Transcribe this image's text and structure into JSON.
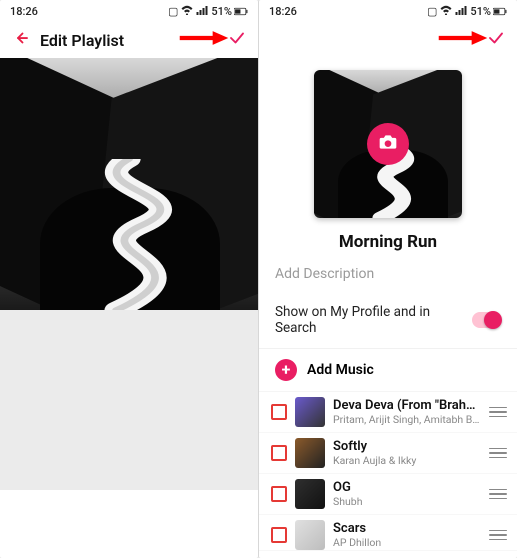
{
  "accent": "#e91e63",
  "statusbar": {
    "time": "18:26",
    "battery": "51%"
  },
  "left": {
    "title": "Edit Playlist"
  },
  "right": {
    "playlist_title": "Morning Run",
    "add_description_placeholder": "Add Description",
    "toggle_label": "Show on My Profile and in Search",
    "add_music_label": "Add Music",
    "songs": [
      {
        "title": "Deva Deva (From \"Brah…",
        "artist": "Pritam, Arijit Singh, Amitabh Bha…"
      },
      {
        "title": "Softly",
        "artist": "Karan Aujla & Ikky"
      },
      {
        "title": "OG",
        "artist": "Shubh"
      },
      {
        "title": "Scars",
        "artist": "AP Dhillon"
      }
    ]
  }
}
